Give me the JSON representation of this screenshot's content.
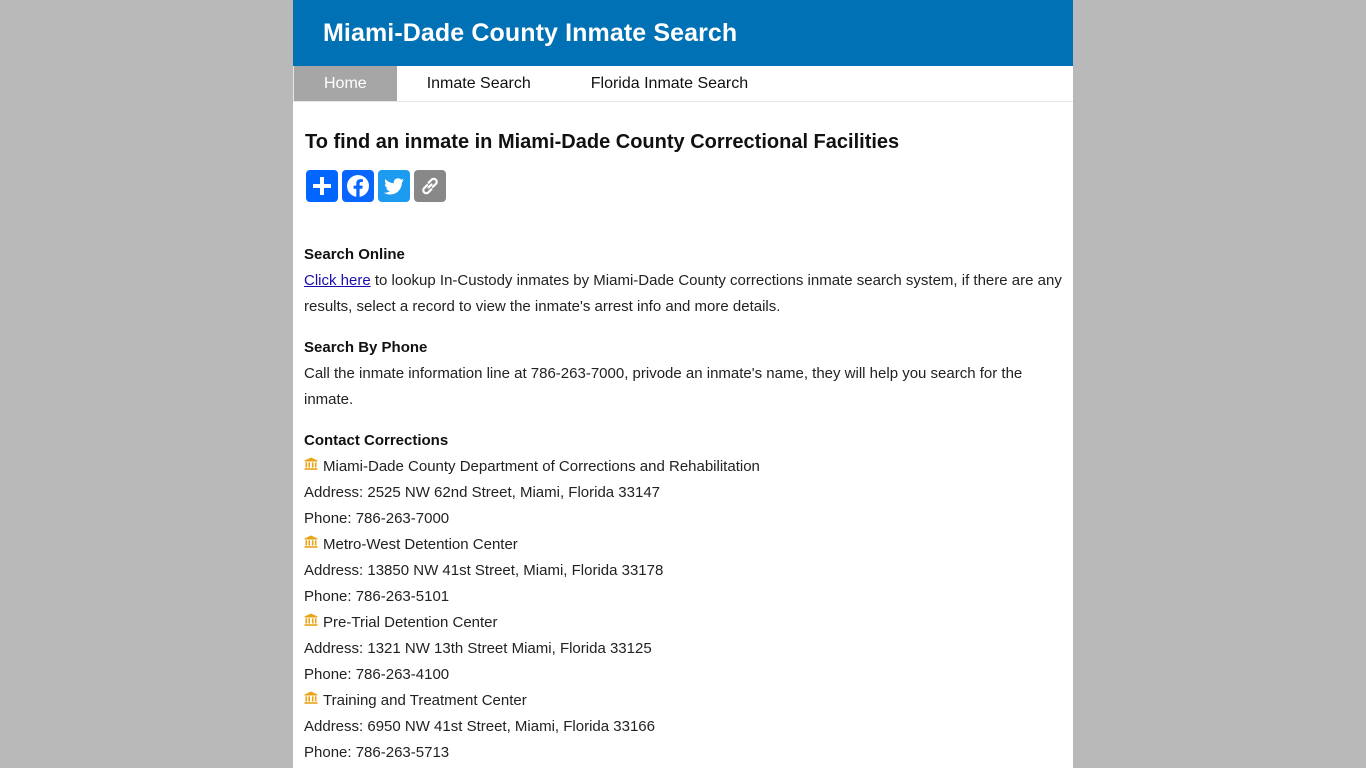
{
  "header": {
    "title": "Miami-Dade County Inmate Search"
  },
  "nav": {
    "items": [
      {
        "label": "Home",
        "active": true
      },
      {
        "label": "Inmate Search",
        "active": false
      },
      {
        "label": "Florida Inmate Search",
        "active": false
      }
    ]
  },
  "main": {
    "heading": "To find an inmate in Miami-Dade County Correctional Facilities",
    "share": [
      {
        "icon": "plus-share-icon",
        "color": "#0166ff"
      },
      {
        "icon": "facebook-icon",
        "color": "#0866ff"
      },
      {
        "icon": "twitter-icon",
        "color": "#1d9bf0"
      },
      {
        "icon": "copy-link-icon",
        "color": "#888888"
      }
    ],
    "search_online": {
      "title": "Search Online",
      "link_text": "Click here",
      "text": " to lookup In-Custody inmates by Miami-Dade County corrections inmate search system, if there are any results, select a record to view the inmate's arrest info and more details."
    },
    "search_phone": {
      "title": "Search By Phone",
      "text": "Call the inmate information line at 786-263-7000, privode an inmate's name, they will help you search for the inmate."
    },
    "contact": {
      "title": "Contact Corrections",
      "facilities": [
        {
          "name": "Miami-Dade County Department of Corrections and Rehabilitation",
          "address": "Address: 2525 NW 62nd Street, Miami, Florida 33147",
          "phone": "Phone: 786-263-7000"
        },
        {
          "name": "Metro-West Detention Center",
          "address": "Address: 13850 NW 41st Street, Miami, Florida 33178",
          "phone": "Phone: 786-263-5101"
        },
        {
          "name": "Pre-Trial Detention Center",
          "address": "Address: 1321 NW 13th Street Miami, Florida 33125",
          "phone": "Phone: 786-263-4100"
        },
        {
          "name": "Training and Treatment Center",
          "address": "Address: 6950 NW 41st Street, Miami, Florida 33166",
          "phone": "Phone: 786-263-5713"
        }
      ],
      "icon": "bank-icon",
      "icon_color": "#e8a317"
    }
  },
  "colors": {
    "header_bg": "#0071b5",
    "nav_active_bg": "#a6a6a6",
    "page_bg": "#b9b9b9"
  }
}
